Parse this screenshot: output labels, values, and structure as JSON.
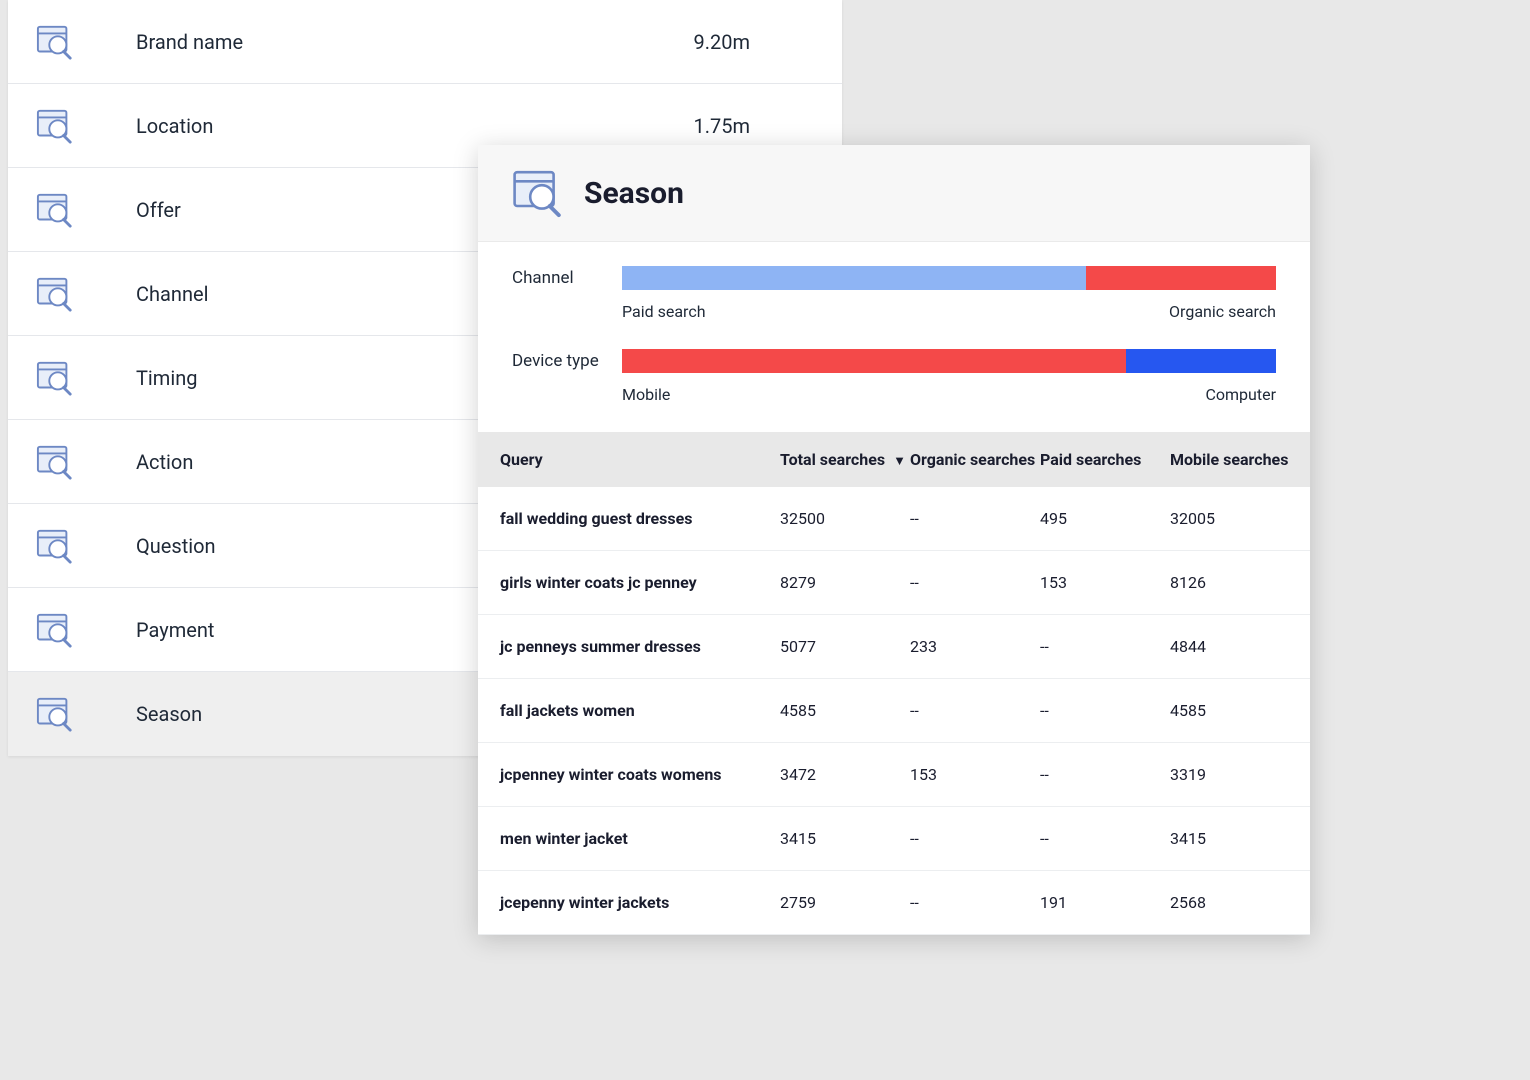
{
  "categories": [
    {
      "label": "Brand name",
      "value": "9.20m",
      "selected": false
    },
    {
      "label": "Location",
      "value": "1.75m",
      "selected": false
    },
    {
      "label": "Offer",
      "value": "",
      "selected": false
    },
    {
      "label": "Channel",
      "value": "",
      "selected": false
    },
    {
      "label": "Timing",
      "value": "",
      "selected": false
    },
    {
      "label": "Action",
      "value": "",
      "selected": false
    },
    {
      "label": "Question",
      "value": "",
      "selected": false
    },
    {
      "label": "Payment",
      "value": "",
      "selected": false
    },
    {
      "label": "Season",
      "value": "",
      "selected": true
    }
  ],
  "panel": {
    "title": "Season",
    "bars": {
      "channel": {
        "label": "Channel",
        "left_label": "Paid search",
        "right_label": "Organic search",
        "left_pct": 71,
        "right_pct": 29,
        "left_color": "#8eb4f4",
        "right_color": "#f44949"
      },
      "device": {
        "label": "Device type",
        "left_label": "Mobile",
        "right_label": "Computer",
        "left_pct": 77,
        "right_pct": 23,
        "left_color": "#f44949",
        "right_color": "#2657f0"
      }
    },
    "table": {
      "columns": {
        "query": "Query",
        "total": "Total searches",
        "organic": "Organic searches",
        "paid": "Paid searches",
        "mobile": "Mobile searches"
      },
      "sort_indicator": "▼",
      "rows": [
        {
          "query": "fall wedding guest dresses",
          "total": "32500",
          "organic": "--",
          "paid": "495",
          "mobile": "32005"
        },
        {
          "query": "girls winter coats jc penney",
          "total": "8279",
          "organic": "--",
          "paid": "153",
          "mobile": "8126"
        },
        {
          "query": "jc penneys summer dresses",
          "total": "5077",
          "organic": "233",
          "paid": "--",
          "mobile": "4844"
        },
        {
          "query": "fall jackets women",
          "total": "4585",
          "organic": "--",
          "paid": "--",
          "mobile": "4585"
        },
        {
          "query": "jcpenney winter coats womens",
          "total": "3472",
          "organic": "153",
          "paid": "--",
          "mobile": "3319"
        },
        {
          "query": "men winter jacket",
          "total": "3415",
          "organic": "--",
          "paid": "--",
          "mobile": "3415"
        },
        {
          "query": "jcepenny winter jackets",
          "total": "2759",
          "organic": "--",
          "paid": "191",
          "mobile": "2568"
        }
      ]
    }
  }
}
